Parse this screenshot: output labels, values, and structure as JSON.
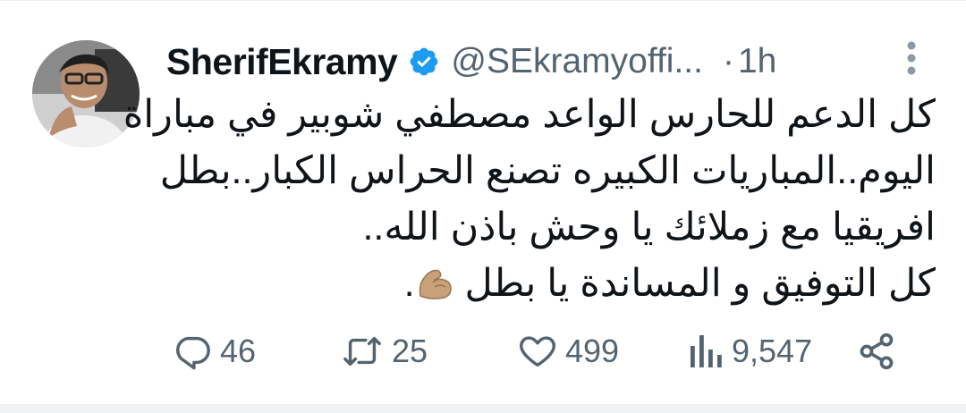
{
  "author": {
    "display_name": "SherifEkramy",
    "handle": "@SEkramyoffi...",
    "separator": "·",
    "time": "1h",
    "verified": true,
    "verified_color": "#1d9bf0"
  },
  "tweet": {
    "lines": [
      "كل الدعم للحارس الواعد مصطفي شوبير في مباراة",
      "اليوم..المباريات الكبيره تصنع الحراس الكبار..بطل",
      "افريقيا مع زملائك يا وحش باذن الله..",
      "كل التوفيق و المساندة يا بطل"
    ],
    "trailing_punctuation": ".",
    "emoji": "flexed-biceps"
  },
  "actions": {
    "replies": "46",
    "retweets": "25",
    "likes": "499",
    "views": "9,547"
  },
  "icons": {
    "reply": "reply-icon",
    "retweet": "retweet-icon",
    "like": "heart-icon",
    "views": "views-icon",
    "share": "share-icon",
    "more": "more-vertical-icon"
  },
  "colors": {
    "text": "#0f1419",
    "secondary": "#536471",
    "verified": "#1d9bf0"
  }
}
